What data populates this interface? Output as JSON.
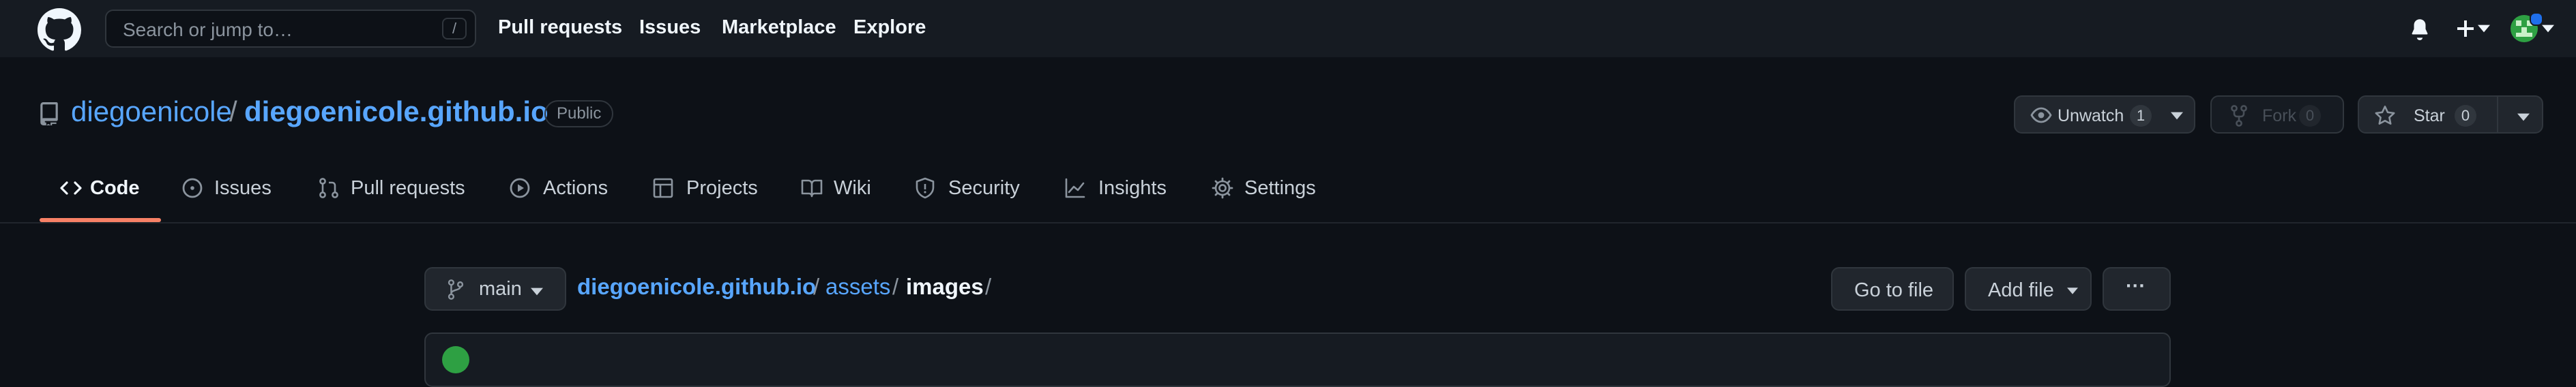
{
  "header": {
    "search_placeholder": "Search or jump to…",
    "slash_key": "/",
    "nav": [
      "Pull requests",
      "Issues",
      "Marketplace",
      "Explore"
    ]
  },
  "repo": {
    "owner": "diegoenicole",
    "separator": "/",
    "name": "diegoenicole.github.io",
    "visibility": "Public"
  },
  "actions": {
    "watch_label": "Unwatch",
    "watch_count": "1",
    "fork_label": "Fork",
    "fork_count": "0",
    "star_label": "Star",
    "star_count": "0"
  },
  "tabs": [
    {
      "label": "Code",
      "icon": "code-icon",
      "active": true
    },
    {
      "label": "Issues",
      "icon": "issue-icon"
    },
    {
      "label": "Pull requests",
      "icon": "pull-request-icon"
    },
    {
      "label": "Actions",
      "icon": "play-icon"
    },
    {
      "label": "Projects",
      "icon": "table-icon"
    },
    {
      "label": "Wiki",
      "icon": "book-icon"
    },
    {
      "label": "Security",
      "icon": "shield-icon"
    },
    {
      "label": "Insights",
      "icon": "graph-icon"
    },
    {
      "label": "Settings",
      "icon": "gear-icon"
    }
  ],
  "file_nav": {
    "branch": "main",
    "breadcrumb": [
      {
        "label": "diegoenicole.github.io"
      },
      {
        "label": "/"
      },
      {
        "label": "assets"
      },
      {
        "label": "/"
      },
      {
        "label": "images"
      },
      {
        "label": "/"
      }
    ],
    "go_to_file": "Go to file",
    "add_file": "Add file",
    "more": "···"
  },
  "colors": {
    "link": "#58a6ff",
    "active_tab": "#f78166",
    "background": "#0d1117",
    "header": "#161b22"
  }
}
